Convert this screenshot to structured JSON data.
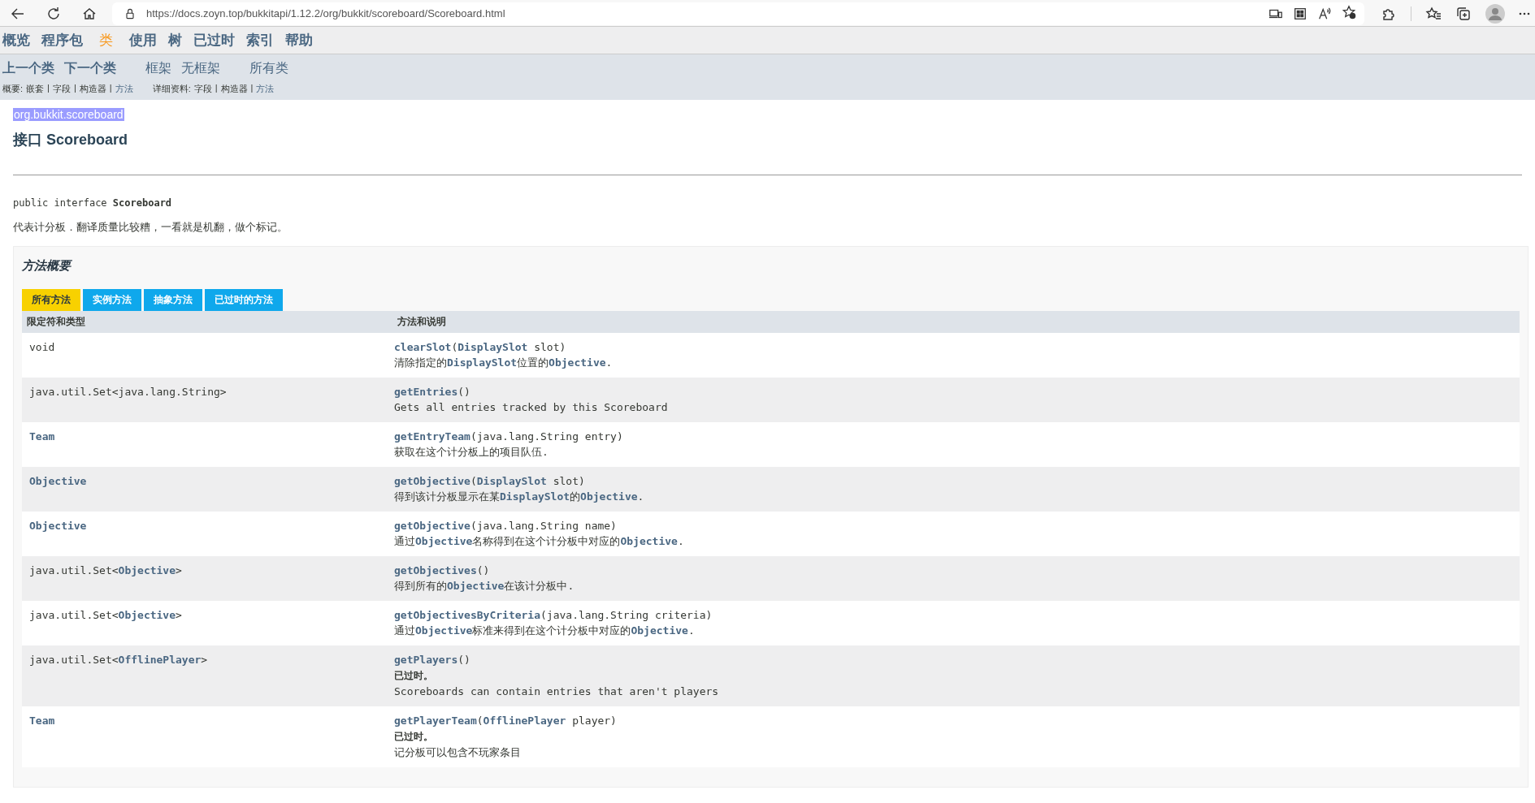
{
  "browser": {
    "url": "https://docs.zoyn.top/bukkitapi/1.12.2/org/bukkit/scoreboard/Scoreboard.html"
  },
  "nav": [
    {
      "label": "概览",
      "selected": false
    },
    {
      "label": "程序包",
      "selected": false
    },
    {
      "label": "类",
      "selected": true
    },
    {
      "label": "使用",
      "selected": false
    },
    {
      "label": "树",
      "selected": false
    },
    {
      "label": "已过时",
      "selected": false
    },
    {
      "label": "索引",
      "selected": false
    },
    {
      "label": "帮助",
      "selected": false
    }
  ],
  "subnav": {
    "prev_next": [
      "上一个类",
      "下一个类"
    ],
    "frames": [
      "框架",
      "无框架"
    ],
    "all_classes": "所有类",
    "summary": {
      "label": "概要:",
      "separator": "|",
      "items": [
        {
          "label": "嵌套",
          "linked": false
        },
        {
          "label": "字段",
          "linked": false
        },
        {
          "label": "构造器",
          "linked": false
        },
        {
          "label": "方法",
          "linked": true
        }
      ]
    },
    "detail": {
      "label": "详细资料:",
      "separator": "|",
      "items": [
        {
          "label": "字段",
          "linked": false
        },
        {
          "label": "构造器",
          "linked": false
        },
        {
          "label": "方法",
          "linked": true
        }
      ]
    }
  },
  "header": {
    "package": "org.bukkit.scoreboard",
    "package_highlighted": true,
    "title": "接口 Scoreboard"
  },
  "signature": "public interface **Scoreboard**",
  "description": "代表计分板．翻译质量比较糟，一看就是机翻，做个标记。",
  "method_summary": {
    "heading": "方法概要",
    "tabs": [
      {
        "label": "所有方法",
        "selected": true
      },
      {
        "label": "实例方法",
        "selected": false
      },
      {
        "label": "抽象方法",
        "selected": false
      },
      {
        "label": "已过时的方法",
        "selected": false
      }
    ],
    "columns": [
      "限定符和类型",
      "方法和说明"
    ],
    "rows": [
      {
        "type": "void",
        "type_linked": false,
        "method": "**clearSlot**(**DisplaySlot** slot)",
        "description": "清除指定的**DisplaySlot**位置的**Objective**."
      },
      {
        "type": "java.util.Set<java.lang.String>",
        "type_linked": false,
        "method": "**getEntries**()",
        "description": "Gets all entries tracked by this Scoreboard"
      },
      {
        "type": "Team",
        "type_linked": true,
        "method": "**getEntryTeam**(java.lang.String entry)",
        "description": "获取在这个计分板上的项目队伍."
      },
      {
        "type": "Objective",
        "type_linked": true,
        "method": "**getObjective**(**DisplaySlot** slot)",
        "description": "得到该计分板显示在某**DisplaySlot**的**Objective**."
      },
      {
        "type": "Objective",
        "type_linked": true,
        "method": "**getObjective**(java.lang.String name)",
        "description": "通过**Objective**名称得到在这个计分板中对应的**Objective**."
      },
      {
        "type": "java.util.Set<**Objective**>",
        "type_linked": false,
        "method": "**getObjectives**()",
        "description": "得到所有的**Objective**在该计分板中."
      },
      {
        "type": "java.util.Set<**Objective**>",
        "type_linked": false,
        "method": "**getObjectivesByCriteria**(java.lang.String criteria)",
        "description": "通过**Objective**标准来得到在这个计分板中对应的**Objective**."
      },
      {
        "type": "java.util.Set<**OfflinePlayer**>",
        "type_linked": false,
        "method": "**getPlayers**()",
        "deprecated": "已过时。",
        "description": "Scoreboards can contain entries that aren't players"
      },
      {
        "type": "Team",
        "type_linked": true,
        "method": "**getPlayerTeam**(**OfflinePlayer** player)",
        "deprecated": "已过时。",
        "description": "记分板可以包含不玩家条目"
      }
    ]
  }
}
